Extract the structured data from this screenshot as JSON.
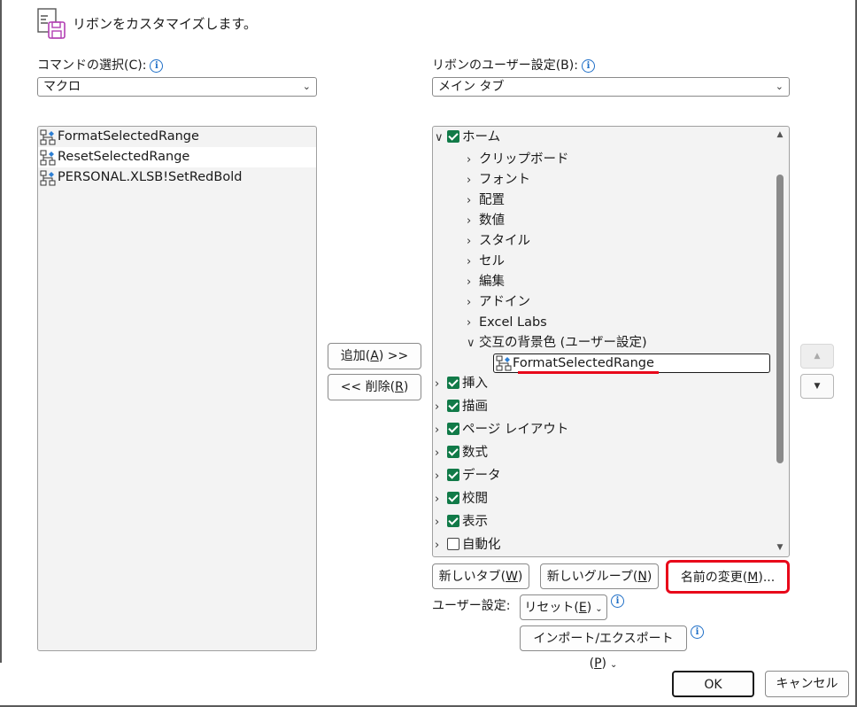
{
  "header": {
    "title": "リボンをカスタマイズします。",
    "icon": "customize-ribbon-icon"
  },
  "commands": {
    "label": "コマンドの選択(C):",
    "selected": "マクロ",
    "items": [
      {
        "label": "FormatSelectedRange",
        "icon": "macro-icon"
      },
      {
        "label": "ResetSelectedRange",
        "icon": "macro-icon"
      },
      {
        "label": "PERSONAL.XLSB!SetRedBold",
        "icon": "macro-icon"
      }
    ]
  },
  "ribbon": {
    "label": "リボンのユーザー設定(B):",
    "selected": "メイン タブ",
    "tree": [
      {
        "label": "ホーム",
        "expanded": true,
        "checked": true
      },
      {
        "label": "クリップボード",
        "expanded": false
      },
      {
        "label": "フォント",
        "expanded": false
      },
      {
        "label": "配置",
        "expanded": false
      },
      {
        "label": "数値",
        "expanded": false
      },
      {
        "label": "スタイル",
        "expanded": false
      },
      {
        "label": "セル",
        "expanded": false
      },
      {
        "label": "編集",
        "expanded": false
      },
      {
        "label": "アドイン",
        "expanded": false
      },
      {
        "label": "Excel Labs",
        "expanded": false
      },
      {
        "label": "交互の背景色 (ユーザー設定)",
        "expanded": true
      },
      {
        "label": "FormatSelectedRange",
        "icon": "macro-icon"
      },
      {
        "label": "挿入",
        "checked": true
      },
      {
        "label": "描画",
        "checked": true
      },
      {
        "label": "ページ レイアウト",
        "checked": true
      },
      {
        "label": "数式",
        "checked": true
      },
      {
        "label": "データ",
        "checked": true
      },
      {
        "label": "校閲",
        "checked": true
      },
      {
        "label": "表示",
        "checked": true
      },
      {
        "label": "自動化",
        "checked": false
      }
    ]
  },
  "buttons": {
    "add_pre": "追加(",
    "add_key": "A",
    "add_post": ") >>",
    "remove_pre": "<< 削除(",
    "remove_key": "R",
    "remove_post": ")",
    "new_tab_pre": "新しいタブ(",
    "new_tab_key": "W",
    "new_tab_post": ")",
    "new_group_pre": "新しいグループ(",
    "new_group_key": "N",
    "new_group_post": ")",
    "rename_pre": "名前の変更(",
    "rename_key": "M",
    "rename_post": ")...",
    "customize_label": "ユーザー設定:",
    "reset_pre": "リセット(",
    "reset_key": "E",
    "reset_post": ")",
    "import_pre": "インポート/エクスポート(",
    "import_key": "P",
    "import_post": ")",
    "ok": "OK",
    "cancel": "キャンセル"
  },
  "colors": {
    "checkbox": "#117a48",
    "highlight": "#e8071a",
    "info": "#1f6fc7"
  }
}
